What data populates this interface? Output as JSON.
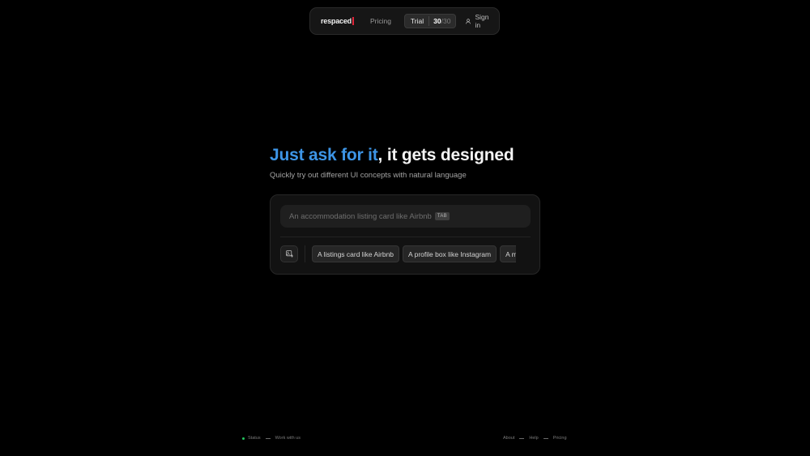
{
  "nav": {
    "logo": "respaced",
    "pricing": "Pricing",
    "trial_label": "Trial",
    "trial_used": "30",
    "trial_total": "/30",
    "signin": "Sign in",
    "signin_icon": "user-icon",
    "brand_accent": "#e0263a"
  },
  "hero": {
    "headline_accent": "Just ask for it",
    "headline_rest": ", it gets designed",
    "subtitle": "Quickly try out different UI concepts with natural language",
    "accent_color": "#3d95e6"
  },
  "prompt": {
    "placeholder": "An accommodation listing card like Airbnb",
    "tab_badge": "TAB",
    "image_button_icon": "image-upload-icon"
  },
  "suggestions": [
    "A listings card like Airbnb",
    "A profile box like Instagram",
    "A music"
  ],
  "footer": {
    "left": [
      "Status",
      "Work with us"
    ],
    "right": [
      "About",
      "Help",
      "Pricing"
    ],
    "status_color": "#22c55e"
  }
}
